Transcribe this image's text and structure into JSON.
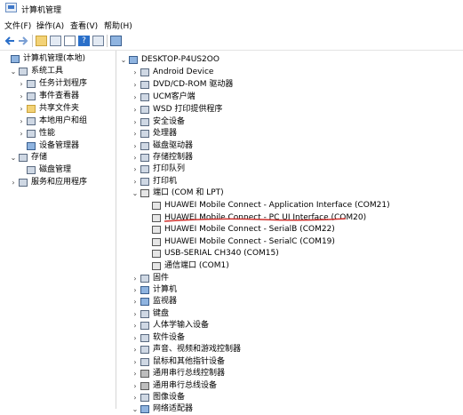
{
  "window": {
    "title": "计算机管理"
  },
  "menu": [
    {
      "name": "menu-file",
      "label": "文件(F)"
    },
    {
      "name": "menu-action",
      "label": "操作(A)"
    },
    {
      "name": "menu-view",
      "label": "查看(V)"
    },
    {
      "name": "menu-help",
      "label": "帮助(H)"
    }
  ],
  "toolbar": [
    {
      "name": "back-arrow-icon",
      "interactable": true
    },
    {
      "name": "forward-arrow-icon",
      "interactable": true
    },
    {
      "name": "up-folder-icon",
      "interactable": true
    },
    {
      "name": "show-hide-console-tree-icon",
      "interactable": true
    },
    {
      "name": "properties-icon",
      "interactable": true
    },
    {
      "name": "help-icon",
      "interactable": true
    },
    {
      "name": "scan-hardware-monitor-icon",
      "interactable": true
    }
  ],
  "left_tree": [
    {
      "name": "tree-computer-management-local",
      "label": "计算机管理(本地)",
      "exp": "",
      "icon": "computer-icon",
      "icls": "ico-monitor"
    },
    {
      "name": "tree-system-tools",
      "label": "系统工具",
      "exp": "⌄",
      "icon": "tools-icon",
      "icls": "ico-gen"
    },
    {
      "name": "tree-task-scheduler",
      "label": "任务计划程序",
      "exp": "›",
      "icon": "clock-icon",
      "icls": "ico-gen"
    },
    {
      "name": "tree-event-viewer",
      "label": "事件查看器",
      "exp": "›",
      "icon": "event-viewer-icon",
      "icls": "ico-gen"
    },
    {
      "name": "tree-shared-folders",
      "label": "共享文件夹",
      "exp": "›",
      "icon": "shared-folder-icon",
      "icls": "ico-folder"
    },
    {
      "name": "tree-local-users-groups",
      "label": "本地用户和组",
      "exp": "›",
      "icon": "users-icon",
      "icls": "ico-gen"
    },
    {
      "name": "tree-performance",
      "label": "性能",
      "exp": "›",
      "icon": "performance-icon",
      "icls": "ico-gen"
    },
    {
      "name": "tree-device-manager",
      "label": "设备管理器",
      "exp": "",
      "icon": "device-manager-icon",
      "icls": "ico-monitor"
    },
    {
      "name": "tree-storage",
      "label": "存储",
      "exp": "⌄",
      "icon": "storage-icon",
      "icls": "ico-gen"
    },
    {
      "name": "tree-disk-management",
      "label": "磁盘管理",
      "exp": "",
      "icon": "disk-icon",
      "icls": "ico-gen"
    },
    {
      "name": "tree-services-applications",
      "label": "服务和应用程序",
      "exp": "›",
      "icon": "services-icon",
      "icls": "ico-gen"
    }
  ],
  "device_tree": [
    {
      "name": "device-root",
      "label": "DESKTOP-P4US2OO",
      "exp": "⌄",
      "icon": "computer-icon",
      "icls": "ico-monitor"
    },
    {
      "name": "device-android",
      "label": "Android Device",
      "exp": "›",
      "icon": "phone-icon",
      "icls": "ico-gen"
    },
    {
      "name": "device-dvd",
      "label": "DVD/CD-ROM 驱动器",
      "exp": "›",
      "icon": "dvd-drive-icon",
      "icls": "ico-gen"
    },
    {
      "name": "device-ucm",
      "label": "UCM客户端",
      "exp": "›",
      "icon": "ucm-icon",
      "icls": "ico-gen"
    },
    {
      "name": "device-wsd",
      "label": "WSD 打印提供程序",
      "exp": "›",
      "icon": "printer-icon",
      "icls": "ico-gen"
    },
    {
      "name": "device-security",
      "label": "安全设备",
      "exp": "›",
      "icon": "security-device-icon",
      "icls": "ico-gen"
    },
    {
      "name": "device-processor",
      "label": "处理器",
      "exp": "›",
      "icon": "processor-icon",
      "icls": "ico-gen"
    },
    {
      "name": "device-disk-drives",
      "label": "磁盘驱动器",
      "exp": "›",
      "icon": "disk-drive-icon",
      "icls": "ico-gen"
    },
    {
      "name": "device-storage-controllers",
      "label": "存储控制器",
      "exp": "›",
      "icon": "storage-controller-icon",
      "icls": "ico-gen"
    },
    {
      "name": "device-print-queues",
      "label": "打印队列",
      "exp": "›",
      "icon": "print-queue-icon",
      "icls": "ico-gen"
    },
    {
      "name": "device-printers",
      "label": "打印机",
      "exp": "›",
      "icon": "printer-icon",
      "icls": "ico-gen"
    },
    {
      "name": "device-ports",
      "label": "端口 (COM 和 LPT)",
      "exp": "⌄",
      "icon": "port-icon",
      "icls": "ico-port"
    },
    {
      "name": "device-port-com21",
      "label": "HUAWEI Mobile Connect - Application Interface (COM21)",
      "exp": "",
      "icon": "port-connector-icon",
      "icls": "ico-port"
    },
    {
      "name": "device-port-com20",
      "label": "HUAWEI Mobile Connect - PC UI Interface (COM20)",
      "exp": "",
      "icon": "port-connector-icon",
      "icls": "ico-port"
    },
    {
      "name": "device-port-com22",
      "label": "HUAWEI Mobile Connect - SerialB (COM22)",
      "exp": "",
      "icon": "port-connector-icon",
      "icls": "ico-port"
    },
    {
      "name": "device-port-com19",
      "label": "HUAWEI Mobile Connect - SerialC (COM19)",
      "exp": "",
      "icon": "port-connector-icon",
      "icls": "ico-port"
    },
    {
      "name": "device-port-com15",
      "label": "USB-SERIAL CH340 (COM15)",
      "exp": "",
      "icon": "port-connector-icon",
      "icls": "ico-port"
    },
    {
      "name": "device-port-com1",
      "label": "通信端口 (COM1)",
      "exp": "",
      "icon": "port-connector-icon",
      "icls": "ico-port"
    },
    {
      "name": "device-firmware",
      "label": "固件",
      "exp": "›",
      "icon": "firmware-icon",
      "icls": "ico-gen"
    },
    {
      "name": "device-computer",
      "label": "计算机",
      "exp": "›",
      "icon": "computer-icon",
      "icls": "ico-monitor"
    },
    {
      "name": "device-monitors",
      "label": "监视器",
      "exp": "›",
      "icon": "monitor-icon",
      "icls": "ico-monitor"
    },
    {
      "name": "device-keyboards",
      "label": "键盘",
      "exp": "›",
      "icon": "keyboard-icon",
      "icls": "ico-gen"
    },
    {
      "name": "device-hid",
      "label": "人体学输入设备",
      "exp": "›",
      "icon": "hid-icon",
      "icls": "ico-gen"
    },
    {
      "name": "device-software",
      "label": "软件设备",
      "exp": "›",
      "icon": "software-device-icon",
      "icls": "ico-gen"
    },
    {
      "name": "device-sound",
      "label": "声音、视频和游戏控制器",
      "exp": "›",
      "icon": "speaker-icon",
      "icls": "ico-gen"
    },
    {
      "name": "device-mice",
      "label": "鼠标和其他指针设备",
      "exp": "›",
      "icon": "mouse-icon",
      "icls": "ico-gen"
    },
    {
      "name": "device-usb-controllers",
      "label": "通用串行总线控制器",
      "exp": "›",
      "icon": "usb-icon",
      "icls": "ico-usb"
    },
    {
      "name": "device-usb-devices",
      "label": "通用串行总线设备",
      "exp": "›",
      "icon": "usb-icon",
      "icls": "ico-usb"
    },
    {
      "name": "device-imaging",
      "label": "图像设备",
      "exp": "›",
      "icon": "camera-icon",
      "icls": "ico-gen"
    },
    {
      "name": "device-network-adapters",
      "label": "网络适配器",
      "exp": "⌄",
      "icon": "network-adapter-icon",
      "icls": "ico-monitor"
    }
  ],
  "annotation": {
    "underline_color": "#d0312d"
  }
}
